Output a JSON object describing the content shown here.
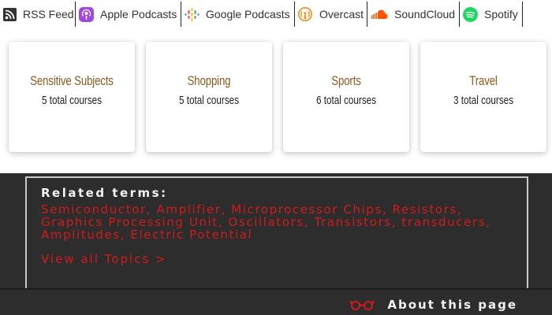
{
  "podcasts": [
    {
      "label": "RSS Feed",
      "icon": "rss-icon"
    },
    {
      "label": "Apple Podcasts",
      "icon": "apple-podcasts-icon"
    },
    {
      "label": "Google Podcasts",
      "icon": "google-podcasts-icon"
    },
    {
      "label": "Overcast",
      "icon": "overcast-icon"
    },
    {
      "label": "SoundCloud",
      "icon": "soundcloud-icon"
    },
    {
      "label": "Spotify",
      "icon": "spotify-icon"
    }
  ],
  "courses": [
    {
      "title": "Sensitive Subjects",
      "count": "5 total courses"
    },
    {
      "title": "Shopping",
      "count": "5 total courses"
    },
    {
      "title": "Sports",
      "count": "6 total courses"
    },
    {
      "title": "Travel",
      "count": "3 total courses"
    }
  ],
  "related": {
    "title": "Related terms:",
    "terms": "Semiconductor, Amplifier, Microprocessor Chips, Resistors, Graphics Processing Unit, Oscillators, Transistors, transducers, Amplitudes, Electric Potential",
    "view_all": "View all Topics >"
  },
  "about": {
    "label": "About this page",
    "icon": "glasses-icon"
  },
  "colors": {
    "accent_red": "#d11a1a",
    "card_title_brown": "#8a5a1e",
    "footer_bg": "#2d2d2d"
  }
}
